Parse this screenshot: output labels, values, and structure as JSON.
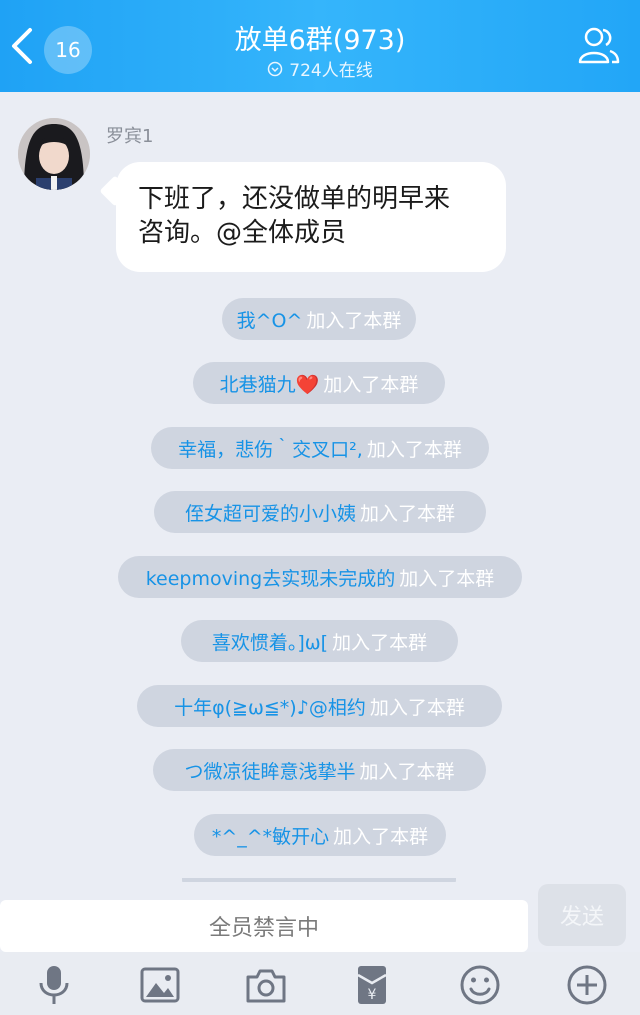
{
  "header": {
    "back_badge": "16",
    "title": "放单6群(973)",
    "online": "724人在线"
  },
  "message": {
    "sender": "罗宾1",
    "text_line1": "下班了，还没做单的明早来",
    "text_line2": "咨询。@全体成员"
  },
  "join_action": "加入了本群",
  "system_messages": [
    {
      "nick": "我^O^"
    },
    {
      "nick": "北巷猫九❤️"
    },
    {
      "nick": "幸福，悲伤｀交叉口²,"
    },
    {
      "nick": "侄女超可爱的小小姨"
    },
    {
      "nick": "keepmoving去实现未完成的"
    },
    {
      "nick": "喜欢惯着。]ω["
    },
    {
      "nick": "十年φ(≧ω≦*)♪@相约"
    },
    {
      "nick": "つ微凉徒眸意浅挚半"
    },
    {
      "nick": "*^_^*敏开心"
    }
  ],
  "input": {
    "placeholder": "全员禁言中",
    "send_label": "发送"
  },
  "toolbar": {
    "icons": [
      "microphone-icon",
      "image-icon",
      "camera-icon",
      "red-packet-icon",
      "emoji-icon",
      "plus-icon"
    ]
  },
  "colors": {
    "header": "#1fa2f5",
    "nick": "#1793e6",
    "pill": "#cfd5e0",
    "background": "#eaedf4"
  }
}
